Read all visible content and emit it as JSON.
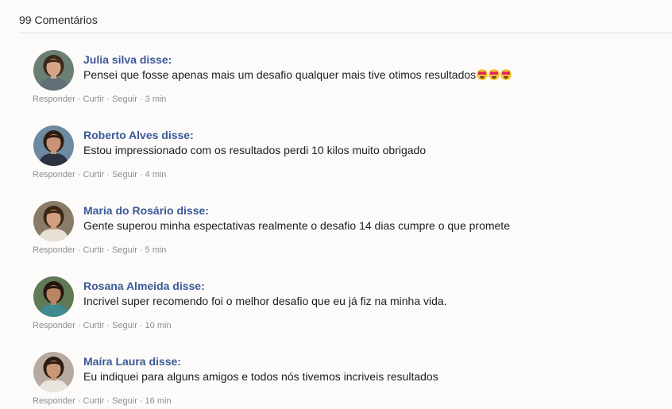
{
  "header": {
    "title": "99 Comentários"
  },
  "actions": {
    "reply": "Responder",
    "like": "Curtir",
    "follow": "Seguir",
    "separator": "·"
  },
  "comments": [
    {
      "author": "Julia silva disse:",
      "text": "Pensei que fosse apenas mais um desafio qualquer mais tive otimos resultados",
      "emoji": "😍😍😍",
      "time": "3 min",
      "avatar": {
        "bg": "#6b7f72",
        "skin": "#d7a585",
        "hair": "#3a2818",
        "shirt": "#5f6e78"
      }
    },
    {
      "author": "Roberto Alves disse:",
      "text": "Estou impressionado com os resultados perdi 10 kilos muito obrigado",
      "emoji": "",
      "time": "4 min",
      "avatar": {
        "bg": "#6e8aa0",
        "skin": "#c99375",
        "hair": "#2a1d14",
        "shirt": "#2b3340"
      }
    },
    {
      "author": "Maria do Rosário disse:",
      "text": "Gente superou minha espectativas realmente o desafio 14 dias cumpre o que promete",
      "emoji": "",
      "time": "5 min",
      "avatar": {
        "bg": "#8a7a68",
        "skin": "#d2a07e",
        "hair": "#3b2716",
        "shirt": "#e7e0d6"
      }
    },
    {
      "author": "Rosana Almeida disse:",
      "text": "Incrivel super recomendo foi o melhor desafio que eu já fiz na minha vida.",
      "emoji": "",
      "time": "10 min",
      "avatar": {
        "bg": "#5f7a55",
        "skin": "#b98562",
        "hair": "#24180f",
        "shirt": "#3f8a8f"
      }
    },
    {
      "author": "Maíra Laura disse:",
      "text": "Eu indiquei para alguns amigos e todos nós tivemos incriveis resultados",
      "emoji": "",
      "time": "16 min",
      "avatar": {
        "bg": "#b8aaa0",
        "skin": "#c99677",
        "hair": "#2c1d12",
        "shirt": "#e9e4de"
      }
    }
  ]
}
